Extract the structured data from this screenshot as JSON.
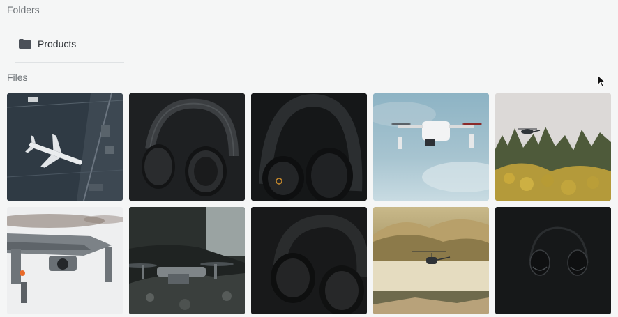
{
  "folders": {
    "title": "Folders",
    "items": [
      {
        "label": "Products",
        "icon": "folder-icon"
      }
    ]
  },
  "files": {
    "title": "Files",
    "items": [
      {
        "subject": "airplane on tarmac",
        "icon": "image-thumbnail"
      },
      {
        "subject": "black headphones",
        "icon": "image-thumbnail"
      },
      {
        "subject": "black headphones close-up",
        "icon": "image-thumbnail"
      },
      {
        "subject": "white drone in sky",
        "icon": "image-thumbnail"
      },
      {
        "subject": "helicopter over trees",
        "icon": "image-thumbnail"
      },
      {
        "subject": "grey drone close-up",
        "icon": "image-thumbnail"
      },
      {
        "subject": "drone on rock",
        "icon": "image-thumbnail"
      },
      {
        "subject": "headphones dark",
        "icon": "image-thumbnail"
      },
      {
        "subject": "helicopter over lake",
        "icon": "image-thumbnail"
      },
      {
        "subject": "headphones silhouette",
        "icon": "image-thumbnail"
      }
    ]
  },
  "colors": {
    "background": "#f5f6f6",
    "section_title": "#6f7478",
    "folder_icon": "#4b5058",
    "text": "#2b2f33"
  }
}
